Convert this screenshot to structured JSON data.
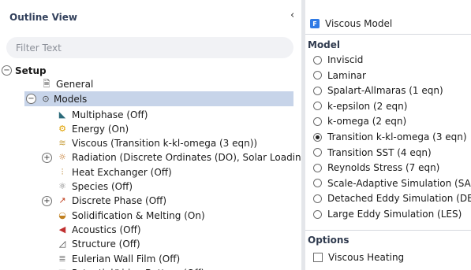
{
  "outline": {
    "title": "Outline View",
    "collapse_glyph": "‹",
    "filter_placeholder": "Filter Text",
    "tree": {
      "setup": {
        "label": "Setup",
        "toggle": "−"
      },
      "general": {
        "label": "General",
        "icon": "general-icon",
        "glyph": "🗎"
      },
      "models": {
        "label": "Models",
        "toggle": "−",
        "icon": "models-icon",
        "glyph": "⊙"
      },
      "items": [
        {
          "label": "Multiphase (Off)",
          "icon": "multiphase-icon",
          "glyph": "◣",
          "color": "#2b6a7a"
        },
        {
          "label": "Energy (On)",
          "icon": "energy-icon",
          "glyph": "⚙",
          "color": "#e0a100"
        },
        {
          "label": "Viscous (Transition k-kl-omega (3 eqn))",
          "icon": "viscous-icon",
          "glyph": "≋",
          "color": "#c8a040"
        },
        {
          "label": "Radiation (Discrete Ordinates (DO), Solar Loading)",
          "icon": "radiation-icon",
          "glyph": "☼",
          "color": "#c07020",
          "toggle": "+"
        },
        {
          "label": "Heat Exchanger (Off)",
          "icon": "heat-exchanger-icon",
          "glyph": "⫶",
          "color": "#b07a20"
        },
        {
          "label": "Species (Off)",
          "icon": "species-icon",
          "glyph": "⚛",
          "color": "#777777"
        },
        {
          "label": "Discrete Phase (Off)",
          "icon": "discrete-phase-icon",
          "glyph": "↗",
          "color": "#c04020",
          "toggle": "+"
        },
        {
          "label": "Solidification & Melting (On)",
          "icon": "solidification-icon",
          "glyph": "◒",
          "color": "#c08020"
        },
        {
          "label": "Acoustics (Off)",
          "icon": "acoustics-icon",
          "glyph": "◀",
          "color": "#c03030"
        },
        {
          "label": "Structure (Off)",
          "icon": "structure-icon",
          "glyph": "◿",
          "color": "#444444"
        },
        {
          "label": "Eulerian Wall Film (Off)",
          "icon": "eulerian-wall-film-icon",
          "glyph": "≣",
          "color": "#777777"
        },
        {
          "label": "Potential/Li-ion Battery (Off)",
          "icon": "battery-icon",
          "glyph": "▤",
          "color": "#555555"
        }
      ]
    }
  },
  "dialog": {
    "app_icon": "F",
    "title": "Viscous Model",
    "model_section": "Model",
    "models": [
      {
        "label": "Inviscid",
        "selected": false
      },
      {
        "label": "Laminar",
        "selected": false
      },
      {
        "label": "Spalart-Allmaras (1 eqn)",
        "selected": false
      },
      {
        "label": "k-epsilon (2 eqn)",
        "selected": false
      },
      {
        "label": "k-omega (2 eqn)",
        "selected": false
      },
      {
        "label": "Transition k-kl-omega (3 eqn)",
        "selected": true
      },
      {
        "label": "Transition SST (4 eqn)",
        "selected": false
      },
      {
        "label": "Reynolds Stress (7 eqn)",
        "selected": false
      },
      {
        "label": "Scale-Adaptive Simulation (SAS)",
        "selected": false
      },
      {
        "label": "Detached Eddy Simulation (DES)",
        "selected": false
      },
      {
        "label": "Large Eddy Simulation (LES)",
        "selected": false
      }
    ],
    "options_section": "Options",
    "options": [
      {
        "label": "Viscous Heating",
        "checked": false
      }
    ]
  }
}
